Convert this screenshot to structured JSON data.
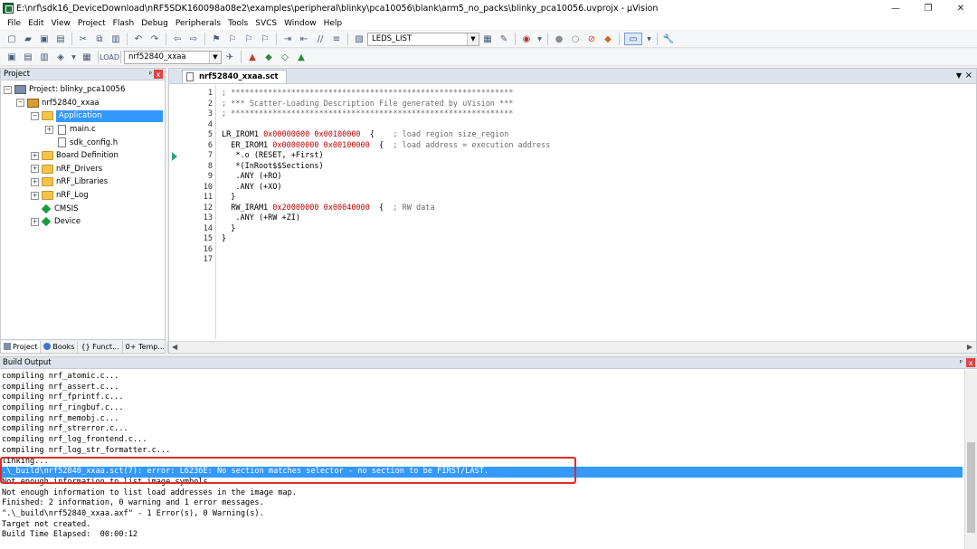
{
  "window": {
    "title": "E:\\nrf\\sdk16_DeviceDownload\\nRF5SDK160098a08e2\\examples\\peripheral\\blinky\\pca10056\\blank\\arm5_no_packs\\blinky_pca10056.uvprojx - µVision",
    "minimize": "—",
    "maximize": "❐",
    "close": "✕"
  },
  "menu": [
    "File",
    "Edit",
    "View",
    "Project",
    "Flash",
    "Debug",
    "Peripherals",
    "Tools",
    "SVCS",
    "Window",
    "Help"
  ],
  "toolbar": {
    "find_combo_value": "LEDS_LIST",
    "target_combo_value": "nrf52840_xxaa"
  },
  "project_pane": {
    "title": "Project",
    "pin": "ᵖ",
    "close": "x",
    "tree": [
      {
        "label": "Project: blinky_pca10056",
        "level": 0,
        "expander": "−",
        "icon": "project"
      },
      {
        "label": "nrf52840_xxaa",
        "level": 1,
        "expander": "−",
        "icon": "target"
      },
      {
        "label": "Application",
        "level": 2,
        "expander": "−",
        "icon": "folder",
        "selected": true
      },
      {
        "label": "main.c",
        "level": 3,
        "expander": "+",
        "icon": "file"
      },
      {
        "label": "sdk_config.h",
        "level": 3,
        "expander": "",
        "icon": "file"
      },
      {
        "label": "Board Definition",
        "level": 2,
        "expander": "+",
        "icon": "folder"
      },
      {
        "label": "nRF_Drivers",
        "level": 2,
        "expander": "+",
        "icon": "folder"
      },
      {
        "label": "nRF_Libraries",
        "level": 2,
        "expander": "+",
        "icon": "folder"
      },
      {
        "label": "nRF_Log",
        "level": 2,
        "expander": "+",
        "icon": "folder"
      },
      {
        "label": "CMSIS",
        "level": 2,
        "expander": "",
        "icon": "gem"
      },
      {
        "label": "Device",
        "level": 2,
        "expander": "+",
        "icon": "gem"
      }
    ],
    "tabs": [
      "Project",
      "Books",
      "{} Funct...",
      "0+ Temp..."
    ]
  },
  "editor": {
    "tab_label": "nrf52840_xxaa.sct",
    "line_numbers": [
      "1",
      "2",
      "3",
      "4",
      "5",
      "6",
      "7",
      "8",
      "9",
      "10",
      "11",
      "12",
      "13",
      "14",
      "15",
      "16",
      "17"
    ],
    "lines": [
      [
        {
          "t": "; *************************************************************",
          "c": "cm"
        }
      ],
      [
        {
          "t": "; *** Scatter-Loading Description File generated by uVision ***",
          "c": "cm"
        }
      ],
      [
        {
          "t": "; *************************************************************",
          "c": "cm"
        }
      ],
      [],
      [
        {
          "t": "LR_IROM1 ",
          "c": ""
        },
        {
          "t": "0x00000000",
          "c": "hx"
        },
        {
          "t": " ",
          "c": ""
        },
        {
          "t": "0x00100000",
          "c": "hx"
        },
        {
          "t": "  {    ",
          "c": ""
        },
        {
          "t": "; load region size_region",
          "c": "cm"
        }
      ],
      [
        {
          "t": "  ER_IROM1 ",
          "c": ""
        },
        {
          "t": "0x00000000",
          "c": "hx"
        },
        {
          "t": " ",
          "c": ""
        },
        {
          "t": "0x00100000",
          "c": "hx"
        },
        {
          "t": "  {  ",
          "c": ""
        },
        {
          "t": "; load address = execution address",
          "c": "cm"
        }
      ],
      [
        {
          "t": "   *.o (RESET, +First)",
          "c": ""
        }
      ],
      [
        {
          "t": "   *(InRoot$$Sections)",
          "c": ""
        }
      ],
      [
        {
          "t": "   .ANY (+RO)",
          "c": ""
        }
      ],
      [
        {
          "t": "   .ANY (+XO)",
          "c": ""
        }
      ],
      [
        {
          "t": "  }",
          "c": ""
        }
      ],
      [
        {
          "t": "  RW_IRAM1 ",
          "c": ""
        },
        {
          "t": "0x20000000",
          "c": "hx"
        },
        {
          "t": " ",
          "c": ""
        },
        {
          "t": "0x00040000",
          "c": "hx"
        },
        {
          "t": "  {  ",
          "c": ""
        },
        {
          "t": "; RW data",
          "c": "cm"
        }
      ],
      [
        {
          "t": "   .ANY (+RW +ZI)",
          "c": ""
        }
      ],
      [
        {
          "t": "  }",
          "c": ""
        }
      ],
      [
        {
          "t": "}",
          "c": ""
        }
      ],
      [],
      []
    ]
  },
  "build_output": {
    "title": "Build Output",
    "pin": "ᵖ",
    "close": "x",
    "lines": [
      {
        "text": "compiling nrf_atomic.c...",
        "style": ""
      },
      {
        "text": "compiling nrf_assert.c...",
        "style": ""
      },
      {
        "text": "compiling nrf_fprintf.c...",
        "style": ""
      },
      {
        "text": "compiling nrf_ringbuf.c...",
        "style": ""
      },
      {
        "text": "compiling nrf_memobj.c...",
        "style": ""
      },
      {
        "text": "compiling nrf_strerror.c...",
        "style": ""
      },
      {
        "text": "compiling nrf_log_frontend.c...",
        "style": ""
      },
      {
        "text": "compiling nrf_log_str_formatter.c...",
        "style": ""
      },
      {
        "text": "linking...",
        "style": ""
      },
      {
        "text": ".\\_build\\nrf52840_xxaa.sct(7): error: L6236E: No section matches selector - no section to be FIRST/LAST.",
        "style": "hl"
      },
      {
        "text": "Not enough information to list image symbols.",
        "style": ""
      },
      {
        "text": "Not enough information to list load addresses in the image map.",
        "style": ""
      },
      {
        "text": "Finished: 2 information, 0 warning and 1 error messages.",
        "style": ""
      },
      {
        "text": "\".\\_build\\nrf52840_xxaa.axf\" - 1 Error(s), 0 Warning(s).",
        "style": ""
      },
      {
        "text": "Target not created.",
        "style": ""
      },
      {
        "text": "Build Time Elapsed:  00:00:12",
        "style": ""
      }
    ]
  }
}
